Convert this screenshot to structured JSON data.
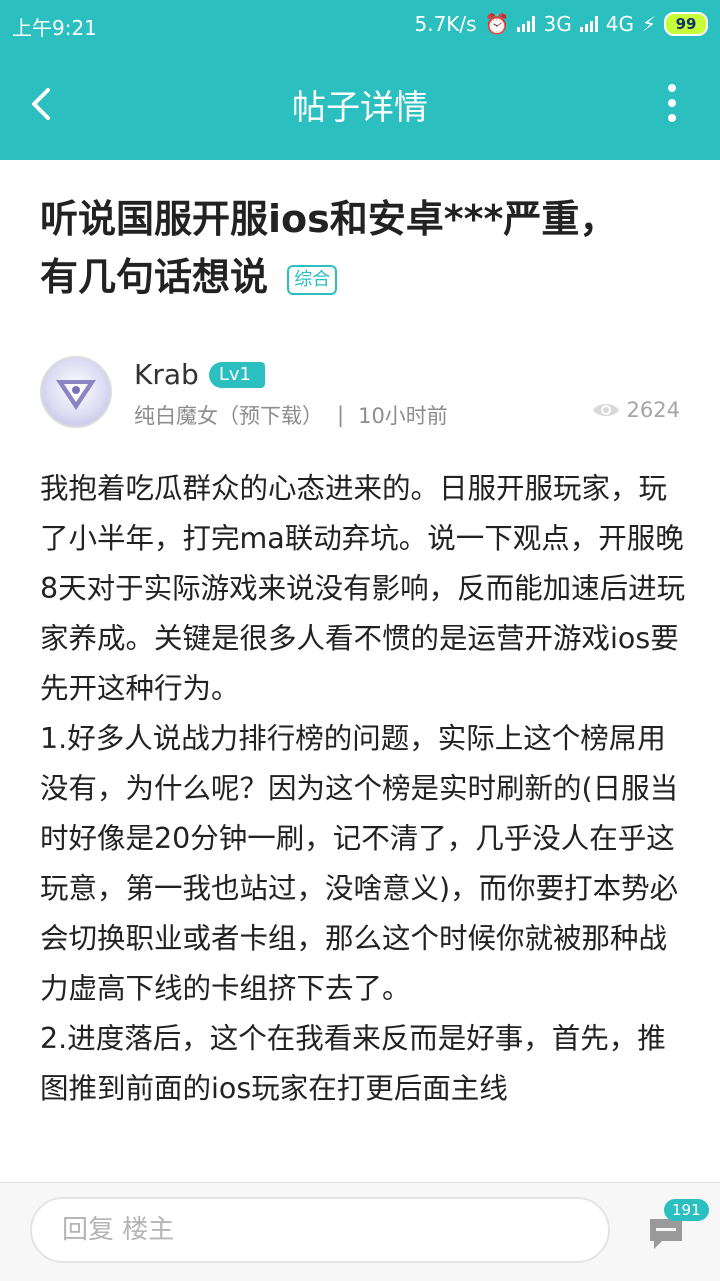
{
  "status_bar": {
    "time": "上午9:21",
    "net_speed": "5.7K/s",
    "network_1": "3G",
    "network_2": "4G",
    "battery": "99"
  },
  "app_bar": {
    "title": "帖子详情",
    "back_icon": "chevron-left-icon",
    "more_icon": "more-vertical-icon"
  },
  "post": {
    "title": "听说国服开服ios和安卓***严重，有几句话想说",
    "tag": "综合",
    "author": "Krab",
    "level": "Lv1",
    "source": "纯白魔女（预下载）",
    "separator": "|",
    "time": "10小时前",
    "views": "2624",
    "paragraphs": [
      "我抱着吃瓜群众的心态进来的。日服开服玩家，玩了小半年，打完ma联动弃坑。说一下观点，开服晚8天对于实际游戏来说没有影响，反而能加速后进玩家养成。关键是很多人看不惯的是运营开游戏ios要先开这种行为。",
      "1.好多人说战力排行榜的问题，实际上这个榜屌用没有，为什么呢？因为这个榜是实时刷新的(日服当时好像是20分钟一刷，记不清了，几乎没人在乎这玩意，第一我也站过，没啥意义)，而你要打本势必会切换职业或者卡组，那么这个时候你就被那种战力虚高下线的卡组挤下去了。",
      "2.进度落后，这个在我看来反而是好事，首先，推图推到前面的ios玩家在打更后面主线"
    ]
  },
  "bottom_bar": {
    "reply_placeholder": "回复  楼主",
    "comment_count": "191",
    "comment_icon": "comment-icon"
  },
  "colors": {
    "accent": "#2bbfbf",
    "text": "#222222",
    "meta": "#8d8d8d"
  }
}
